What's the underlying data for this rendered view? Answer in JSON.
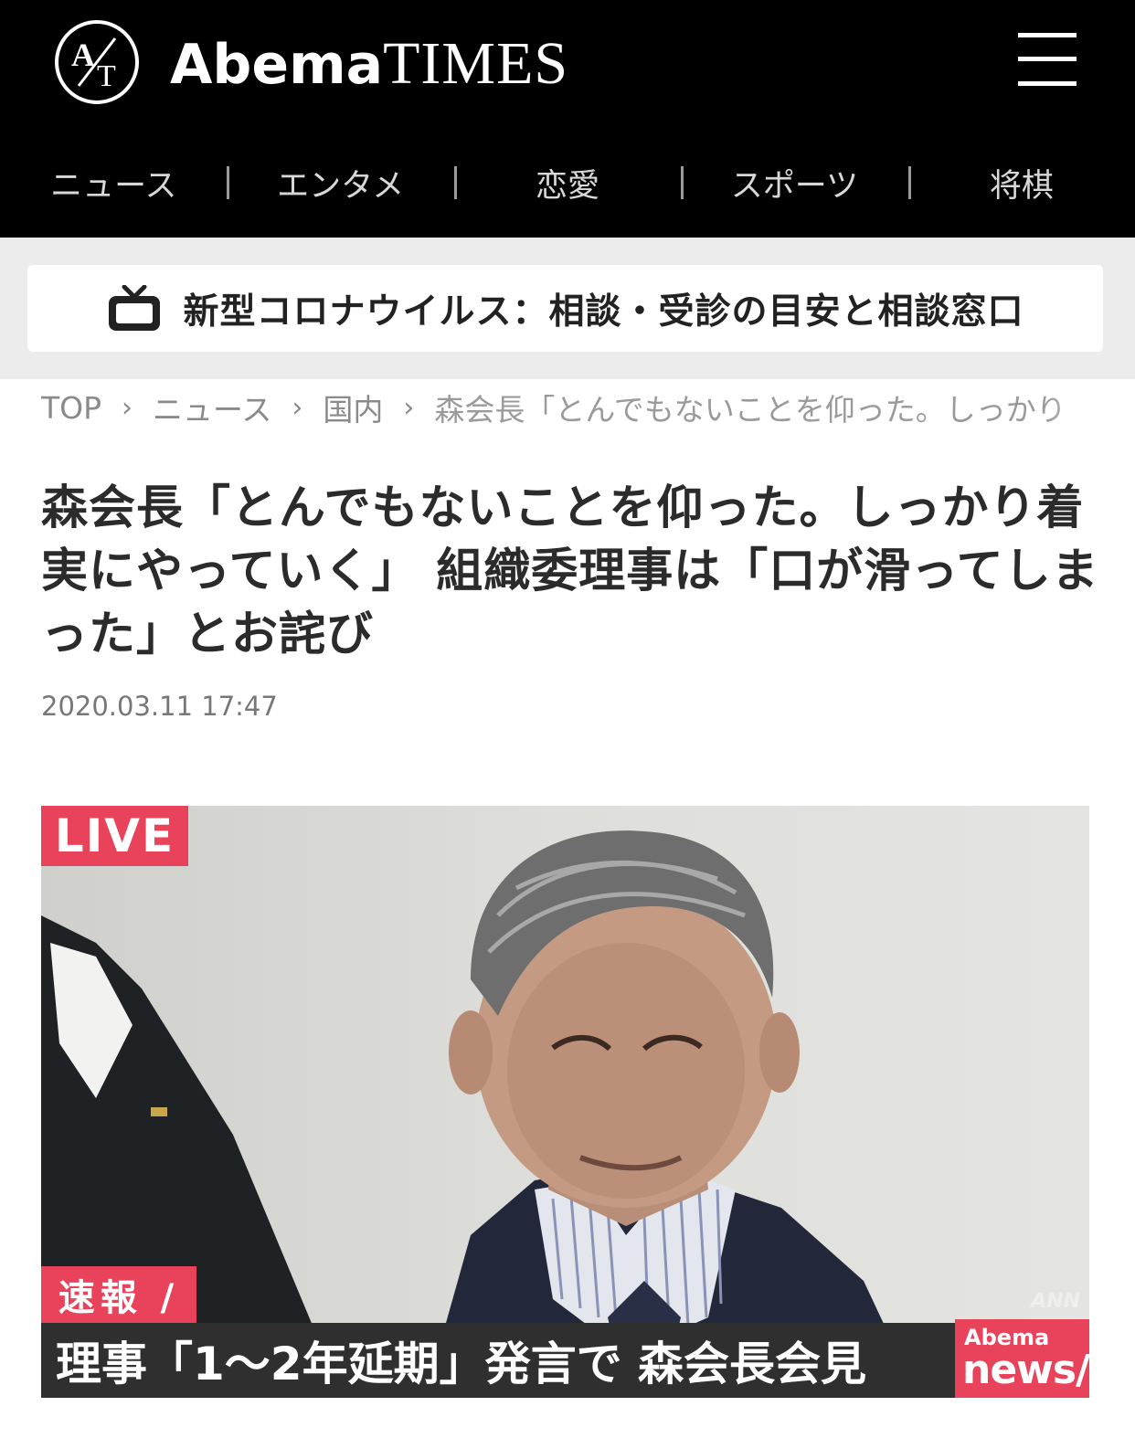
{
  "header": {
    "logo_mark": "A/T",
    "logo_part1": "Abema",
    "logo_part2": "TIMES",
    "menu_icon": "hamburger-menu-icon"
  },
  "nav": [
    "ニュース",
    "エンタメ",
    "恋愛",
    "スポーツ",
    "将棋"
  ],
  "banner": {
    "icon": "tv-icon",
    "text": "新型コロナウイルス：相談・受診の目安と相談窓口"
  },
  "breadcrumb": {
    "items": [
      "TOP",
      "ニュース",
      "国内"
    ],
    "current": "森会長「とんでもないことを仰った。しっかり",
    "separator": ">"
  },
  "article": {
    "title": "森会長「とんでもないことを仰った。しっかり着実にやっていく」 組織委理事は「口が滑ってしまった」とお詫び",
    "date": "2020.03.11 17:47"
  },
  "video": {
    "live_label": "LIVE",
    "flash_label": "速報 /",
    "ticker": "理事「1～2年延期」発言で 森会長会見",
    "watermark": "ANN",
    "brand_top": "Abema",
    "brand_bottom": "news/",
    "colors": {
      "accent": "#e8435b",
      "ticker_bg": "#2f2f2f"
    }
  }
}
